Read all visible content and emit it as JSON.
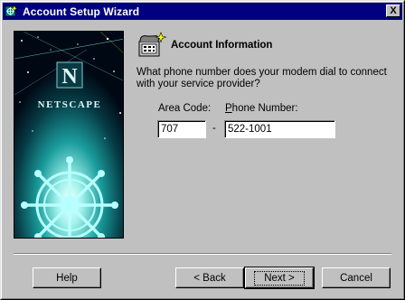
{
  "window": {
    "title": "Account Setup Wizard",
    "title_bar_color": "#000080",
    "icon": "netscape-wizard-icon",
    "close_glyph": "X"
  },
  "side_panel": {
    "logo_letter": "N",
    "brand": "NETSCAPE",
    "image": "netscape-ship-wheel-illustration"
  },
  "main": {
    "icon": "phone-wizard-icon",
    "heading": "Account Information",
    "question": "What phone number does your modem dial to connect with your service provider?",
    "area_code": {
      "label": "Area Code:",
      "value": "707"
    },
    "separator": "-",
    "phone_number": {
      "label_accel": "P",
      "label_rest": "hone Number:",
      "value": "522-1001"
    }
  },
  "buttons": {
    "help": "Help",
    "back": "< Back",
    "next": "Next >",
    "cancel": "Cancel"
  }
}
